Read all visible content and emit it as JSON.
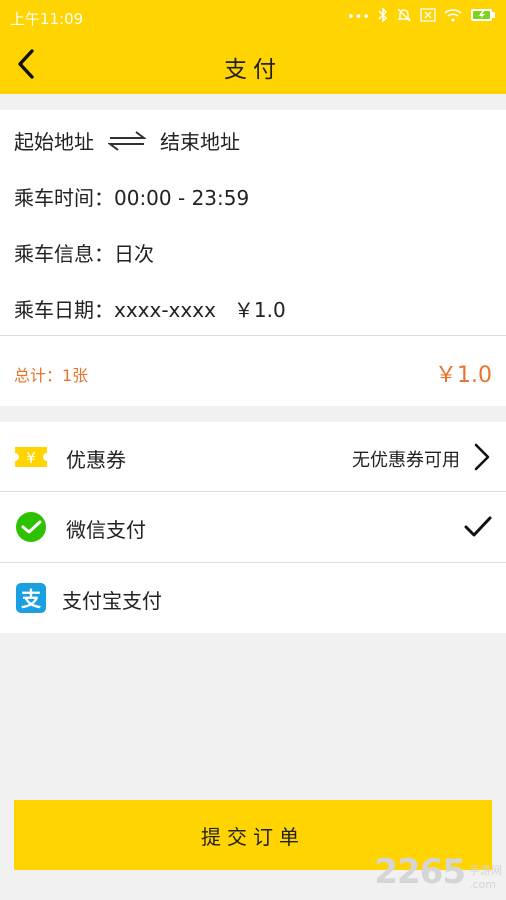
{
  "status_bar": {
    "time": "上午11:09",
    "icons": [
      "more-dots-icon",
      "bluetooth-icon",
      "mute-icon",
      "sim-icon",
      "wifi-icon",
      "battery-icon"
    ]
  },
  "header": {
    "title": "支付",
    "back_icon": "chevron-left-icon"
  },
  "trip": {
    "start_address": "起始地址",
    "end_address": "结束地址",
    "time": "乘车时间：00:00 - 23:59",
    "info": "乘车信息：日次",
    "date": "乘车日期：xxxx-xxxx",
    "price": "￥1.0"
  },
  "summary": {
    "total_label": "总计：1张",
    "total_price": "￥1.0"
  },
  "payment": {
    "coupon_label": "优惠券",
    "coupon_status": "无优惠券可用",
    "wechat_label": "微信支付",
    "alipay_label": "支付宝支付"
  },
  "actions": {
    "submit_label": "提交订单"
  },
  "watermark": {
    "number": "2265",
    "line1": "手游网",
    "line2": ".com"
  },
  "colors": {
    "brand_yellow": "#ffd400",
    "accent_orange": "#e8732c",
    "wechat_green": "#2dc100",
    "alipay_blue": "#1a9fe0"
  }
}
